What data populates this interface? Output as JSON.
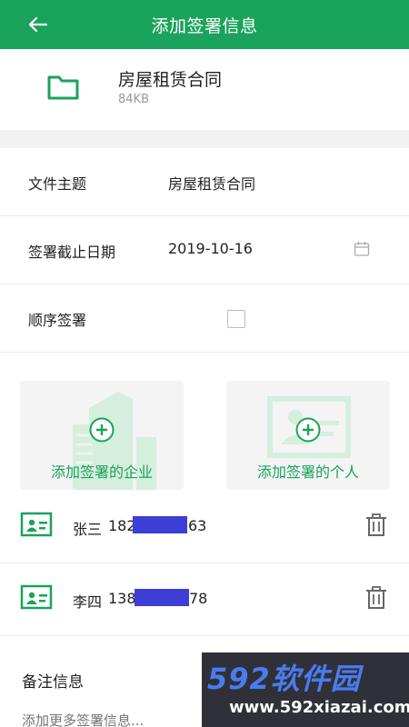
{
  "header": {
    "title": "添加签署信息",
    "back_icon": "arrow-left-icon"
  },
  "file": {
    "name": "房屋租赁合同",
    "size": "84KB",
    "icon": "folder-icon"
  },
  "form": {
    "subject_label": "文件主题",
    "subject_value": "房屋租赁合同",
    "deadline_label": "签署截止日期",
    "deadline_value": "2019-10-16",
    "sequential_label": "顺序签署",
    "sequential_checked": false
  },
  "add": {
    "company_label": "添加签署的企业",
    "person_label": "添加签署的个人"
  },
  "signers": [
    {
      "name": "张三",
      "phone_prefix": "182",
      "phone_suffix": "63"
    },
    {
      "name": "李四",
      "phone_prefix": "138",
      "phone_suffix": "78"
    }
  ],
  "notes": {
    "label": "备注信息",
    "placeholder": "添加更多签署信息..."
  },
  "watermark": {
    "brand": "592软件园",
    "url": "www.592xiazai.com"
  },
  "colors": {
    "accent": "#1aa35a",
    "redaction": "#3d3ed6"
  }
}
